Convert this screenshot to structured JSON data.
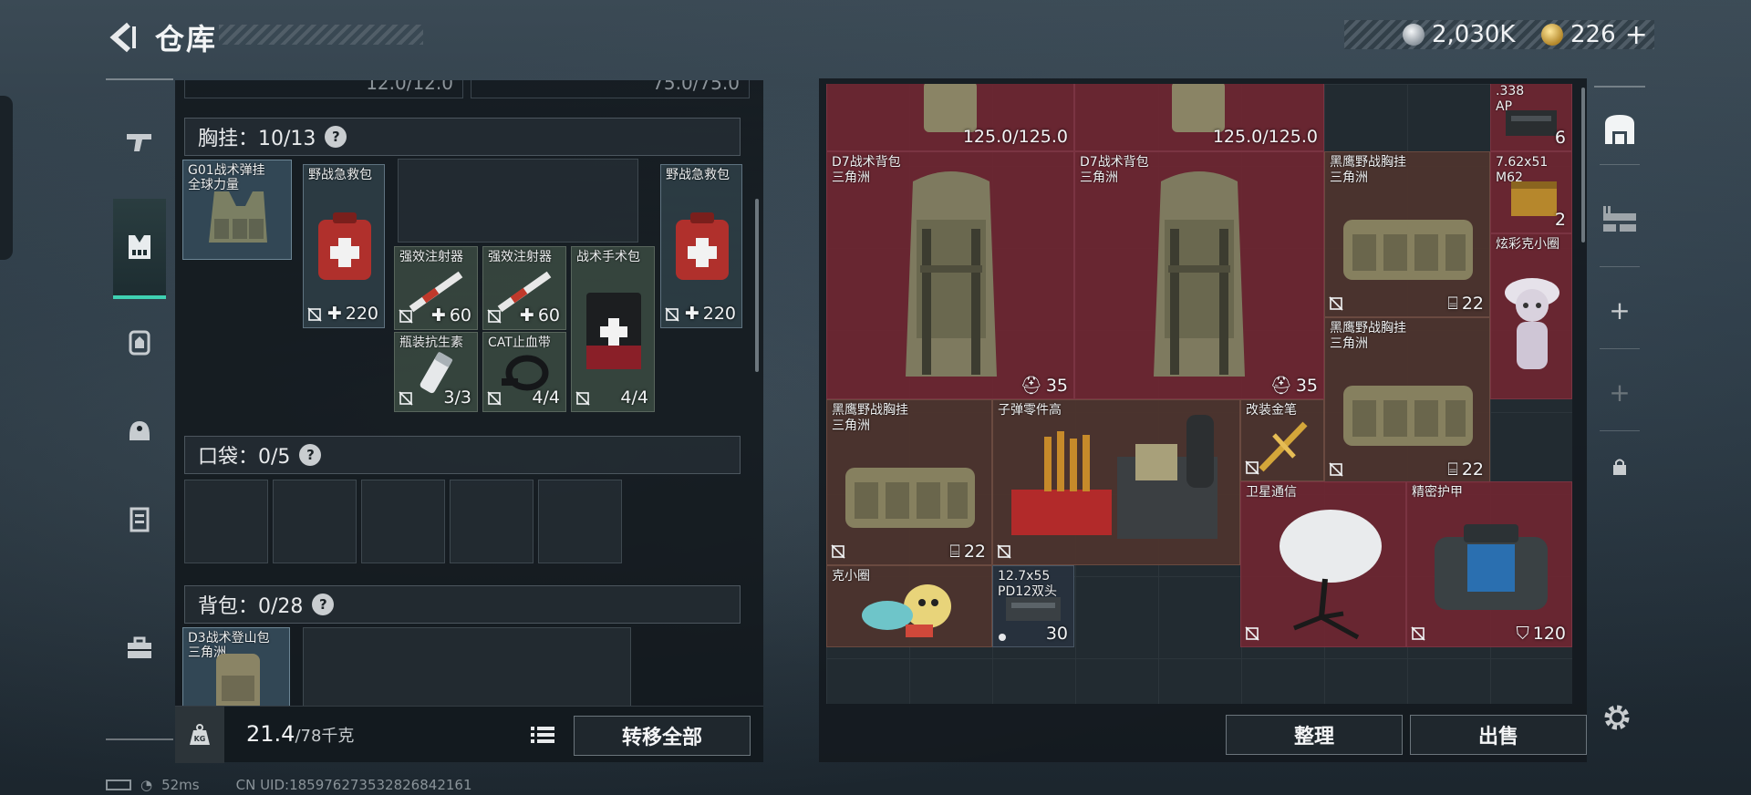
{
  "header": {
    "title": "仓库",
    "currency_silver": "2,030K",
    "currency_gold": "226",
    "plus_label": "+"
  },
  "left": {
    "top_partial_1": "12.0/12.0",
    "top_partial_2": "75.0/75.0",
    "chest_rig_header": "胸挂：10/13",
    "pocket_header": "口袋：0/5",
    "backpack_header": "背包：0/28",
    "help_label": "?",
    "chest_items": [
      {
        "name_line1": "G01战术弹挂",
        "name_line2": "全球力量"
      },
      {
        "name": "野战急救包",
        "value": "220"
      },
      {
        "name": "强效注射器",
        "value": "60"
      },
      {
        "name": "强效注射器",
        "value": "60"
      },
      {
        "name": "战术手术包",
        "value": "4/4"
      },
      {
        "name": "野战急救包",
        "value": "220"
      },
      {
        "name": "瓶装抗生素",
        "value": "3/3"
      },
      {
        "name": "CAT止血带",
        "value": "4/4"
      }
    ],
    "backpack_item": {
      "name_line1": "D3战术登山包",
      "name_line2": "三角洲"
    },
    "weight_value": "21.4",
    "weight_max": "/78千克",
    "transfer_all": "转移全部"
  },
  "right": {
    "durability_1": "125.0/125.0",
    "durability_2": "125.0/125.0",
    "ammo_338": {
      "name_line1": ".338",
      "name_line2": "AP",
      "count": "6"
    },
    "items": [
      {
        "name_line1": "D7战术背包",
        "name_line2": "三角洲",
        "value": "35"
      },
      {
        "name_line1": "D7战术背包",
        "name_line2": "三角洲",
        "value": "35"
      },
      {
        "name_line1": "黑鹰野战胸挂",
        "name_line2": "三角洲",
        "value": "22"
      },
      {
        "name_line1": "7.62x51",
        "name_line2": "M62",
        "count": "2"
      },
      {
        "name": "炫彩克小圈"
      },
      {
        "name_line1": "黑鹰野战胸挂",
        "name_line2": "三角洲",
        "value": "22"
      },
      {
        "name_line1": "黑鹰野战胸挂",
        "name_line2": "三角洲",
        "value": "22"
      },
      {
        "name": "子弹零件高"
      },
      {
        "name": "改装金笔"
      },
      {
        "name": "卫星通信"
      },
      {
        "name": "精密护甲",
        "value": "120"
      },
      {
        "name": "克小圈"
      },
      {
        "name_line1": "12.7x55",
        "name_line2": "PD12双头",
        "count": "30"
      }
    ],
    "sort_label": "整理",
    "sell_label": "出售"
  },
  "status": {
    "ping": "52ms",
    "uid": "CN UID:1859762735328268421​61"
  },
  "colors": {
    "accent": "#3fd1b2",
    "red_cell": "#70263a",
    "brown_cell": "#4e342e",
    "green_cell": "#384840"
  }
}
